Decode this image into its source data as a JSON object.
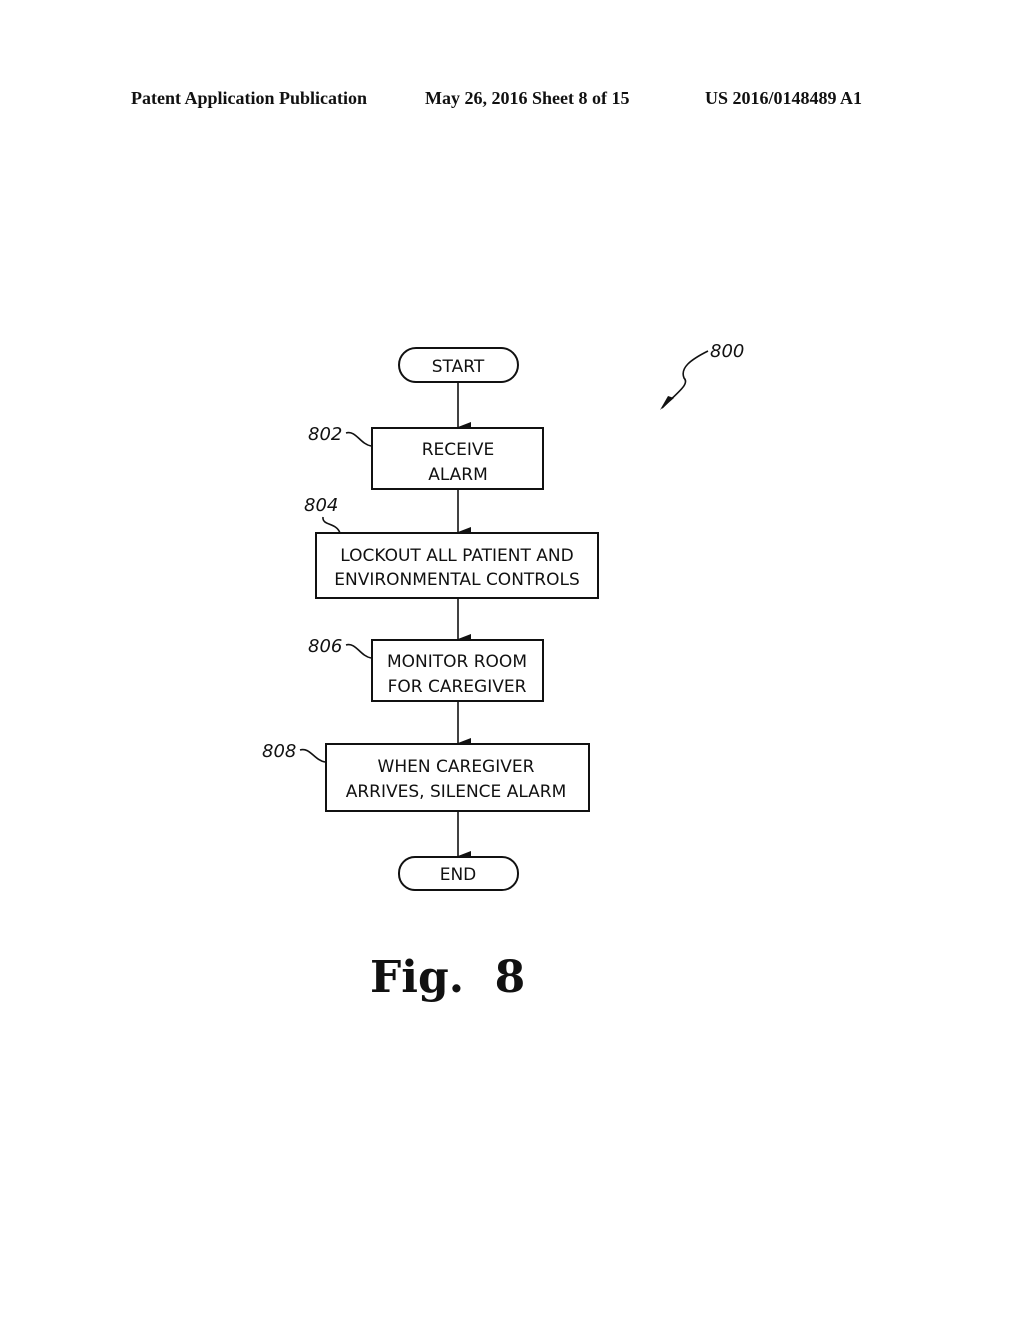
{
  "header": {
    "publication": "Patent Application Publication",
    "date_sheet": "May 26, 2016  Sheet 8 of 15",
    "number": "US 2016/0148489 A1"
  },
  "diagram": {
    "ref_main": "800",
    "start": "START",
    "end": "END",
    "steps": [
      {
        "ref": "802",
        "lines": [
          "RECEIVE",
          "ALARM"
        ]
      },
      {
        "ref": "804",
        "lines": [
          "LOCKOUT ALL PATIENT AND",
          "ENVIRONMENTAL CONTROLS"
        ]
      },
      {
        "ref": "806",
        "lines": [
          "MONITOR ROOM",
          "FOR CAREGIVER"
        ]
      },
      {
        "ref": "808",
        "lines": [
          "WHEN CAREGIVER",
          "ARRIVES, SILENCE ALARM"
        ]
      }
    ]
  },
  "figure_label": "Fig.  8"
}
